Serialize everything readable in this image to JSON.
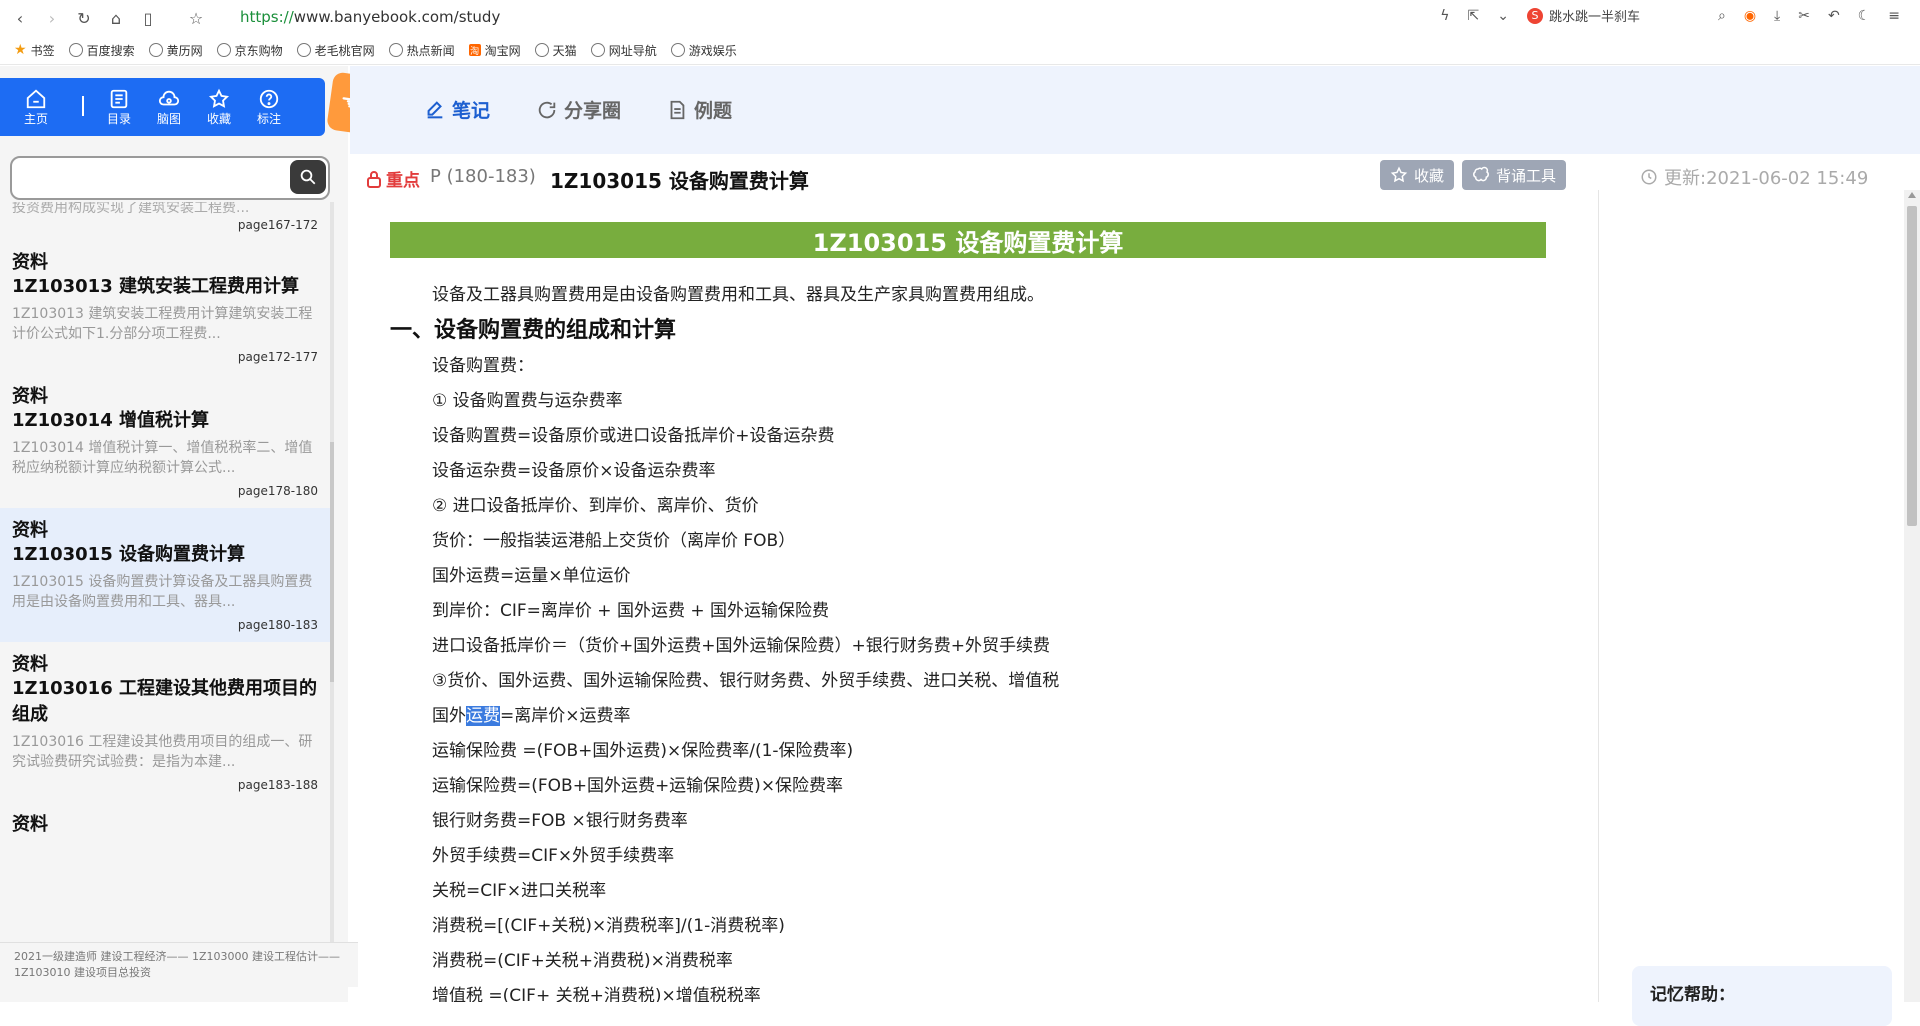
{
  "browser": {
    "url_scheme": "https://",
    "url_rest": "www.banyebook.com/study",
    "search_text": "跳水跳一半刹车"
  },
  "bookmarks": [
    "书签",
    "百度搜索",
    "黄历网",
    "京东购物",
    "老毛桃官网",
    "热点新闻",
    "淘宝网",
    "天猫",
    "网址导航",
    "游戏娱乐"
  ],
  "toolbar": {
    "home": "主页",
    "items": [
      "目录",
      "脑图",
      "收藏",
      "标注"
    ]
  },
  "search": {
    "value": "",
    "placeholder": ""
  },
  "list": {
    "partial": {
      "snippet": "投资费用构成实现了建筑安装工程费...",
      "page": "page167-172"
    },
    "items": [
      {
        "cat": "资料",
        "title": "1Z103013 建筑安装工程费用计算",
        "snippet": "1Z103013 建筑安装工程费用计算建筑安装工程计价公式如下1.分部分项工程费...",
        "page": "page172-177"
      },
      {
        "cat": "资料",
        "title": "1Z103014 增值税计算",
        "snippet": "1Z103014 增值税计算一、增值税税率二、增值税应纳税额计算应纳税额计算公式...",
        "page": "page178-180"
      },
      {
        "cat": "资料",
        "title": "1Z103015 设备购置费计算",
        "snippet": "1Z103015 设备购置费计算设备及工器具购置费用是由设备购置费用和工具、器具...",
        "page": "page180-183"
      },
      {
        "cat": "资料",
        "title": "1Z103016 工程建设其他费用项目的组成",
        "snippet": "1Z103016 工程建设其他费用项目的组成一、研究试验费研究试验费：是指为本建...",
        "page": "page183-188"
      },
      {
        "cat": "资料",
        "title": "",
        "snippet": "",
        "page": ""
      }
    ],
    "footer": "2021一级建造师 建设工程经济—— 1Z103000 建设工程估计—— 1Z103010 建设项目总投资"
  },
  "tabs": [
    "笔记",
    "分享圈",
    "例题"
  ],
  "titlebar": {
    "badge": "重点",
    "pages": "P (180-183)",
    "title": "1Z103015 设备购置费计算",
    "favorite": "收藏",
    "recite": "背诵工具",
    "updated": "更新:2021-06-02 15:49"
  },
  "doc": {
    "banner": "1Z103015 设备购置费计算",
    "intro": "设备及工器具购置费用是由设备购置费用和工具、器具及生产家具购置费用组成。",
    "heading": "一、设备购置费的组成和计算",
    "lines": [
      "设备购置费：",
      "① 设备购置费与运杂费率",
      "设备购置费=设备原价或进口设备抵岸价+设备运杂费",
      "设备运杂费=设备原价×设备运杂费率",
      "② 进口设备抵岸价、到岸价、离岸价、货价",
      "货价：一般指装运港船上交货价（离岸价 FOB）",
      "国外运费=运量×单位运价",
      "到岸价：CIF=离岸价 + 国外运费 + 国外运输保险费",
      "进口设备抵岸价＝（货价+国外运费+国外运输保险费）+银行财务费+外贸手续费",
      "③货价、国外运费、国外运输保险费、银行财务费、外贸手续费、进口关税、增值税"
    ],
    "hl_line": {
      "before": "国外",
      "highlight": "运费",
      "after": "=离岸价×运费率"
    },
    "lines2": [
      "运输保险费 =(FOB+国外运费)×保险费率/(1-保险费率)",
      "运输保险费=(FOB+国外运费+运输保险费)×保险费率",
      "银行财务费=FOB ×银行财务费率",
      "外贸手续费=CIF×外贸手续费率",
      "关税=CIF×进口关税率",
      "消费税=[(CIF+关税)×消费税率]/(1-消费税率)",
      "消费税=(CIF+关税+消费税)×消费税率",
      "增值税 =(CIF+ 关税+消费税)×增值税税率"
    ]
  },
  "memo": {
    "label": "记忆帮助："
  },
  "colors": {
    "accent": "#1d6cf3",
    "banner": "#78ad3e",
    "badge": "#e23c3c",
    "back_tab": "#ff9a3c"
  }
}
